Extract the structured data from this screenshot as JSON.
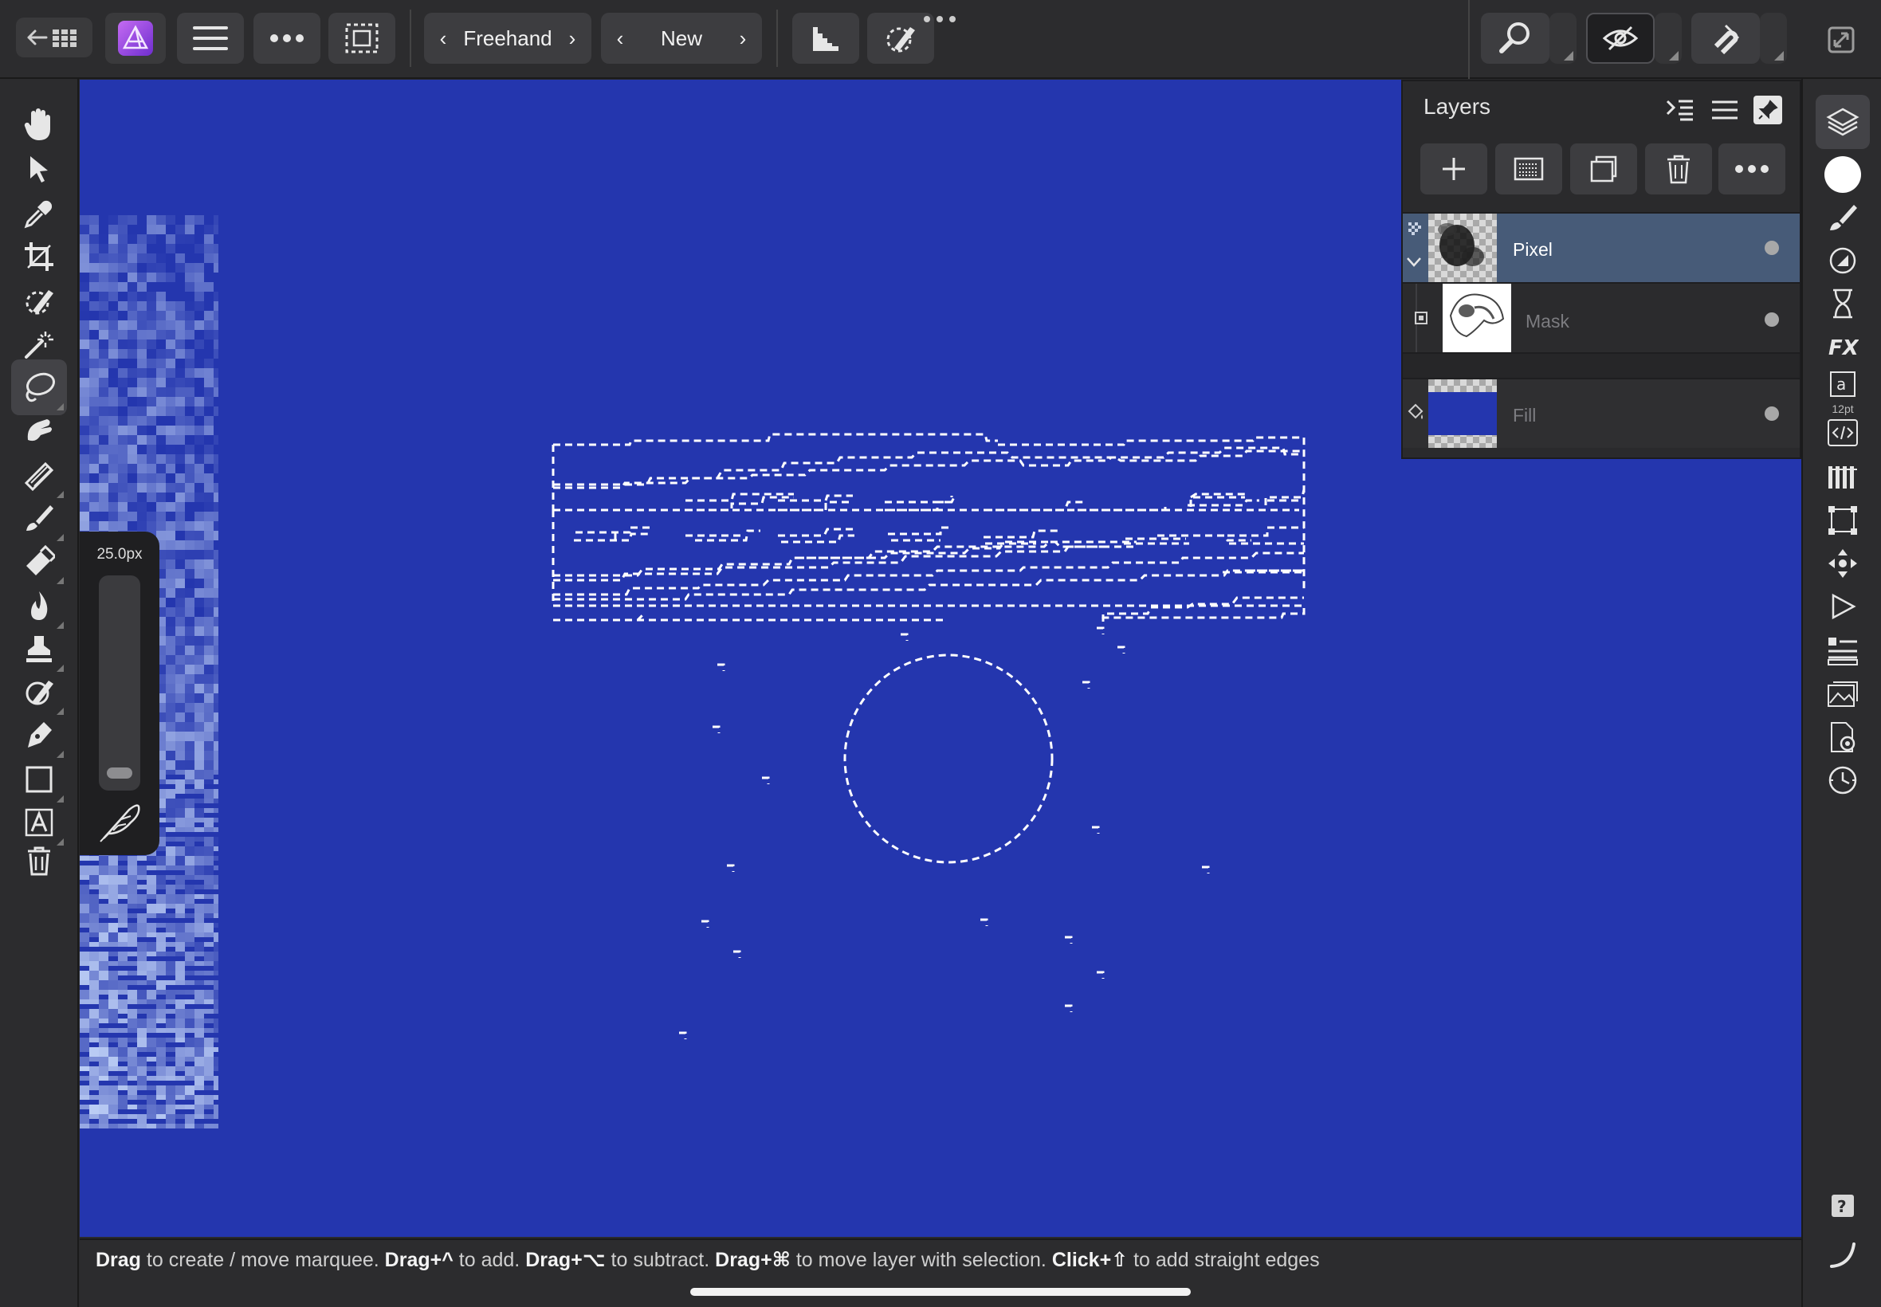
{
  "toolbar": {
    "selection_mode": "Freehand",
    "new_mode": "New"
  },
  "brush": {
    "size": "25.0px"
  },
  "layers_panel": {
    "title": "Layers",
    "layers": [
      {
        "name": "Pixel",
        "selected": true,
        "visible": true
      },
      {
        "name": "Mask",
        "selected": false,
        "visible": true
      },
      {
        "name": "Fill",
        "selected": false,
        "visible": true
      }
    ]
  },
  "right_bar": {
    "text_size_label": "12pt"
  },
  "status": {
    "p1": "Drag",
    "p2": " to create / move marquee. ",
    "p3": "Drag+^",
    "p4": " to add. ",
    "p5": "Drag+⌥",
    "p6": " to subtract. ",
    "p7": "Drag+⌘",
    "p8": " to move layer with selection. ",
    "p9": "Click+⇧",
    "p10": " to add straight edges"
  },
  "colors": {
    "canvas": "#2436ae",
    "accent_affinity": "#8b3fd9",
    "selected_layer": "#475b78",
    "primary_color": "#ffffff"
  }
}
